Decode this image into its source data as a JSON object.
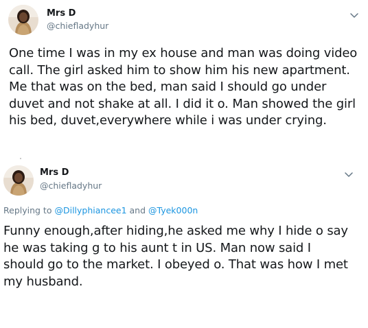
{
  "tweets": [
    {
      "display_name": "Mrs D",
      "handle": "@chiefladyhur",
      "avatar_icon": "profile-avatar",
      "menu_icon": "chevron-down-icon",
      "text": "One time I was in my ex house and man was doing video call. The girl asked him to show him his new apartment. Me that was on the bed, man said I should go under duvet and not shake at all. I did it o. Man showed the girl his bed, duvet,everywhere while i was under crying."
    },
    {
      "display_name": "Mrs D",
      "handle": "@chiefladyhur",
      "avatar_icon": "profile-avatar",
      "menu_icon": "chevron-down-icon",
      "replying": {
        "prefix": "Replying to",
        "mention_1": "@Dillyphiancee1",
        "conjunction": "and",
        "mention_2": "@Tyek000n"
      },
      "text": "Funny enough,after hiding,he asked me why I hide o say he was taking g to his aunt t in US. Man now said I should go to the market. I obeyed o. That was how I met my husband."
    }
  ],
  "colors": {
    "text": "#14171a",
    "secondary": "#657786",
    "link": "#1b95e0",
    "background": "#ffffff"
  }
}
